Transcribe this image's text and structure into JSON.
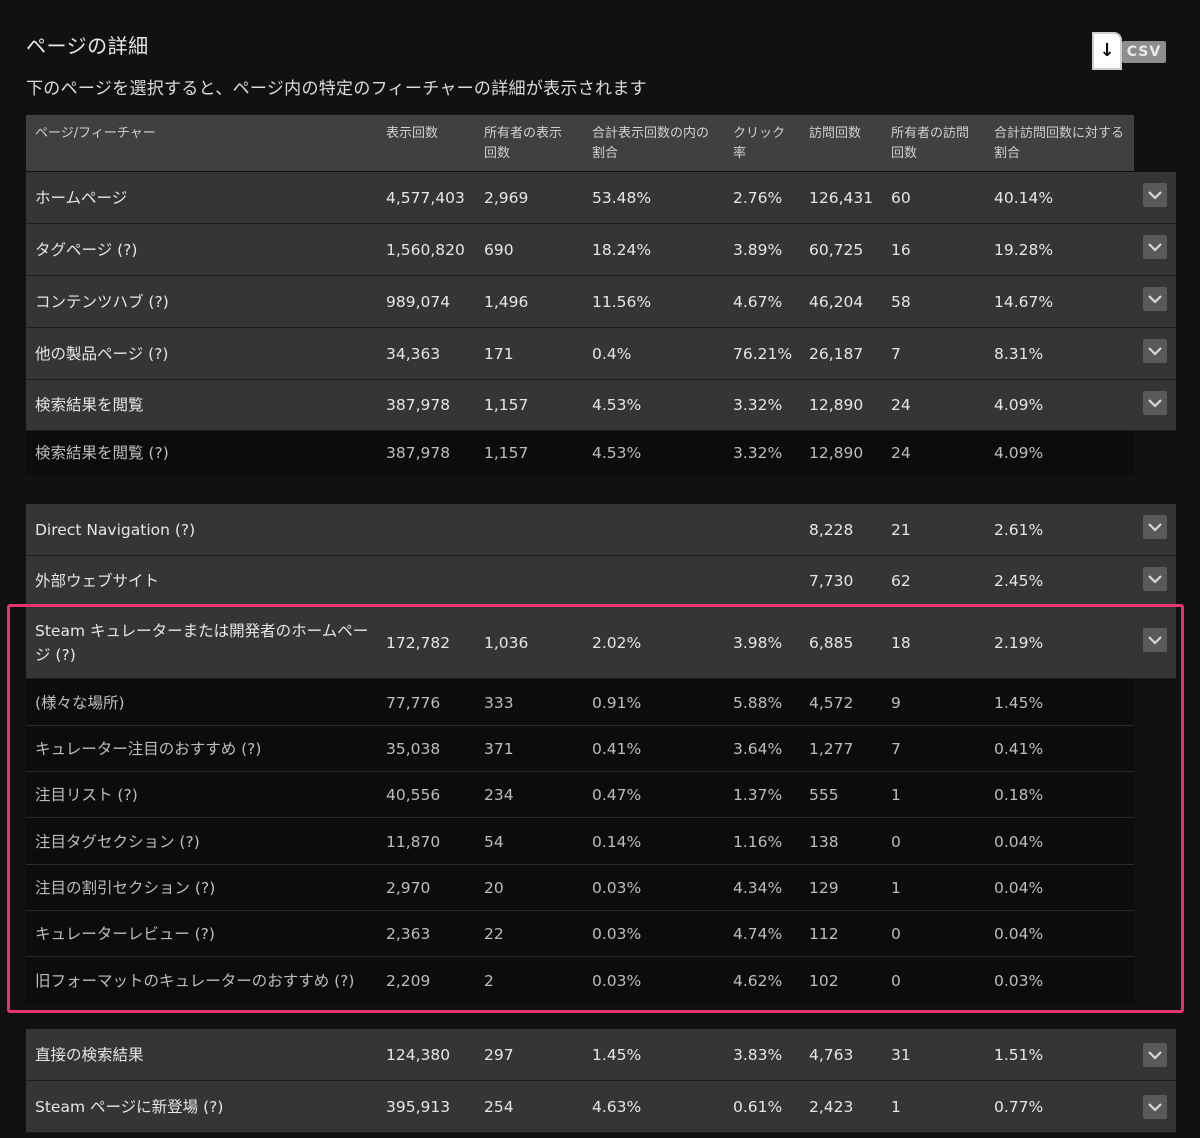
{
  "page": {
    "title": "ページの詳細",
    "subtitle": "下のページを選択すると、ページ内の特定のフィーチャーの詳細が表示されます",
    "csv_label": "CSV"
  },
  "table": {
    "headers": [
      "ページ/フィーチャー",
      "表示回数",
      "所有者の表示回数",
      "合計表示回数の内の割合",
      "クリック率",
      "訪問回数",
      "所有者の訪問回数",
      "合計訪問回数に対する割合"
    ],
    "rows": [
      {
        "name": "ホームページ",
        "views": "4,577,403",
        "owner_views": "2,969",
        "view_share": "53.48%",
        "ctr": "2.76%",
        "visits": "126,431",
        "owner_visits": "60",
        "visit_share": "40.14%"
      },
      {
        "name": "タグページ (?)",
        "views": "1,560,820",
        "owner_views": "690",
        "view_share": "18.24%",
        "ctr": "3.89%",
        "visits": "60,725",
        "owner_visits": "16",
        "visit_share": "19.28%"
      },
      {
        "name": "コンテンツハブ (?)",
        "views": "989,074",
        "owner_views": "1,496",
        "view_share": "11.56%",
        "ctr": "4.67%",
        "visits": "46,204",
        "owner_visits": "58",
        "visit_share": "14.67%"
      },
      {
        "name": "他の製品ページ (?)",
        "views": "34,363",
        "owner_views": "171",
        "view_share": "0.4%",
        "ctr": "76.21%",
        "visits": "26,187",
        "owner_visits": "7",
        "visit_share": "8.31%"
      },
      {
        "name": "検索結果を閲覧",
        "views": "387,978",
        "owner_views": "1,157",
        "view_share": "4.53%",
        "ctr": "3.32%",
        "visits": "12,890",
        "owner_visits": "24",
        "visit_share": "4.09%"
      },
      {
        "name": "検索結果を閲覧 (?)",
        "views": "387,978",
        "owner_views": "1,157",
        "view_share": "4.53%",
        "ctr": "3.32%",
        "visits": "12,890",
        "owner_visits": "24",
        "visit_share": "4.09%"
      },
      {
        "name": "Direct Navigation (?)",
        "views": "",
        "owner_views": "",
        "view_share": "",
        "ctr": "",
        "visits": "8,228",
        "owner_visits": "21",
        "visit_share": "2.61%"
      },
      {
        "name": "外部ウェブサイト",
        "views": "",
        "owner_views": "",
        "view_share": "",
        "ctr": "",
        "visits": "7,730",
        "owner_visits": "62",
        "visit_share": "2.45%"
      },
      {
        "name": "Steam キュレーターまたは開発者のホームページ (?)",
        "views": "172,782",
        "owner_views": "1,036",
        "view_share": "2.02%",
        "ctr": "3.98%",
        "visits": "6,885",
        "owner_visits": "18",
        "visit_share": "2.19%"
      },
      {
        "name": "(様々な場所)",
        "views": "77,776",
        "owner_views": "333",
        "view_share": "0.91%",
        "ctr": "5.88%",
        "visits": "4,572",
        "owner_visits": "9",
        "visit_share": "1.45%"
      },
      {
        "name": "キュレーター注目のおすすめ (?)",
        "views": "35,038",
        "owner_views": "371",
        "view_share": "0.41%",
        "ctr": "3.64%",
        "visits": "1,277",
        "owner_visits": "7",
        "visit_share": "0.41%"
      },
      {
        "name": "注目リスト (?)",
        "views": "40,556",
        "owner_views": "234",
        "view_share": "0.47%",
        "ctr": "1.37%",
        "visits": "555",
        "owner_visits": "1",
        "visit_share": "0.18%"
      },
      {
        "name": "注目タグセクション (?)",
        "views": "11,870",
        "owner_views": "54",
        "view_share": "0.14%",
        "ctr": "1.16%",
        "visits": "138",
        "owner_visits": "0",
        "visit_share": "0.04%"
      },
      {
        "name": "注目の割引セクション (?)",
        "views": "2,970",
        "owner_views": "20",
        "view_share": "0.03%",
        "ctr": "4.34%",
        "visits": "129",
        "owner_visits": "1",
        "visit_share": "0.04%"
      },
      {
        "name": "キュレーターレビュー (?)",
        "views": "2,363",
        "owner_views": "22",
        "view_share": "0.03%",
        "ctr": "4.74%",
        "visits": "112",
        "owner_visits": "0",
        "visit_share": "0.04%"
      },
      {
        "name": "旧フォーマットのキュレーターのおすすめ (?)",
        "views": "2,209",
        "owner_views": "2",
        "view_share": "0.03%",
        "ctr": "4.62%",
        "visits": "102",
        "owner_visits": "0",
        "visit_share": "0.03%"
      },
      {
        "name": "直接の検索結果",
        "views": "124,380",
        "owner_views": "297",
        "view_share": "1.45%",
        "ctr": "3.83%",
        "visits": "4,763",
        "owner_visits": "31",
        "visit_share": "1.51%"
      },
      {
        "name": "Steam ページに新登場 (?)",
        "views": "395,913",
        "owner_views": "254",
        "view_share": "4.63%",
        "ctr": "0.61%",
        "visits": "2,423",
        "owner_visits": "1",
        "visit_share": "0.77%"
      }
    ]
  },
  "colors": {
    "background": "#111112",
    "row_main": "#353535",
    "row_sub": "#0c0c0c",
    "header": "#404040",
    "highlight": "#e5356a"
  }
}
